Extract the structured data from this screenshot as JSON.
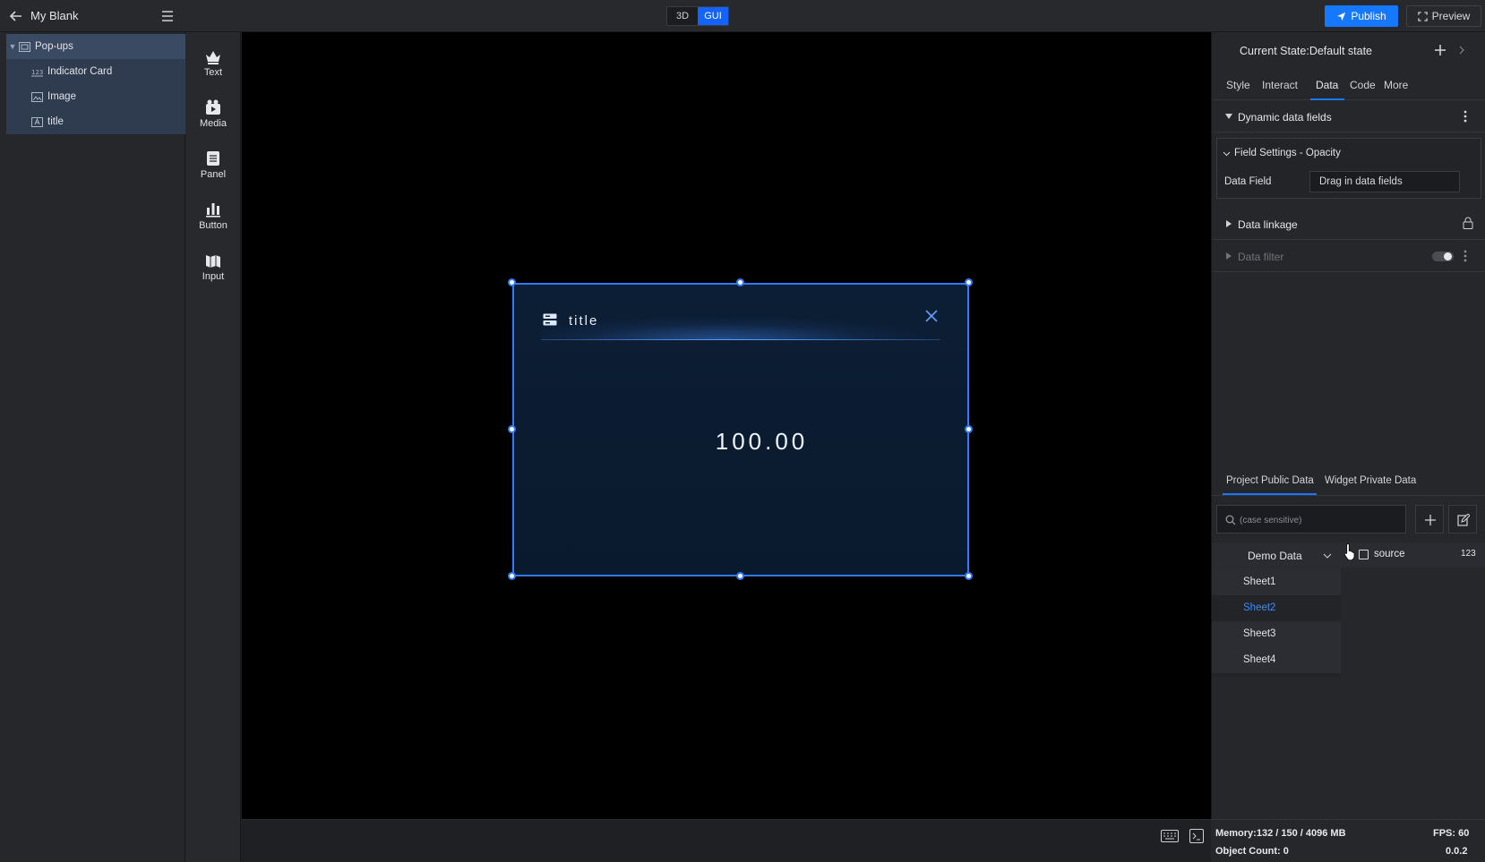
{
  "app": {
    "title": "My Blank"
  },
  "mode_switch": {
    "options": [
      "3D",
      "GUI"
    ],
    "active": "GUI"
  },
  "header": {
    "publish_label": "Publish",
    "preview_label": "Preview"
  },
  "layers": {
    "root": {
      "label": "Pop-ups",
      "icon": "popup-layer-icon"
    },
    "children": [
      {
        "label": "Indicator Card",
        "icon": "indicator-layer-icon"
      },
      {
        "label": "Image",
        "icon": "image-layer-icon"
      },
      {
        "label": "title",
        "icon": "text-layer-icon"
      }
    ]
  },
  "palette": [
    {
      "label": "Text",
      "icon": "text-component-icon"
    },
    {
      "label": "Media",
      "icon": "media-component-icon"
    },
    {
      "label": "Panel",
      "icon": "panel-component-icon"
    },
    {
      "label": "Button",
      "icon": "button-component-icon"
    },
    {
      "label": "Input",
      "icon": "input-component-icon"
    }
  ],
  "popup": {
    "title": "title",
    "value": "100.00"
  },
  "properties": {
    "current_state": "Current State:Default state",
    "tabs": [
      "Style",
      "Interact",
      "Data",
      "Code",
      "More"
    ],
    "active_tab": "Data",
    "dynamic_fields_title": "Dynamic data fields",
    "field_settings_title": "Field Settings - Opacity",
    "data_field_label": "Data Field",
    "data_field_placeholder": "Drag in data fields",
    "data_linkage_title": "Data linkage",
    "data_filter_title": "Data filter"
  },
  "data_panel": {
    "tabs": [
      "Project Public Data",
      "Widget Private Data"
    ],
    "active_tab": "Project Public Data",
    "search_placeholder": "(case sensitive)",
    "source_group": "Demo Data",
    "sheets": [
      "Sheet1",
      "Sheet2",
      "Sheet3",
      "Sheet4"
    ],
    "active_sheet": "Sheet2",
    "fields": [
      {
        "name": "source",
        "type": "123"
      }
    ]
  },
  "status": {
    "memory": "Memory:132 / 150 / 4096 MB",
    "fps": "FPS: 60",
    "object_count": "Object Count: 0",
    "version": "0.0.2"
  },
  "colors": {
    "accent": "#1677ff",
    "canvas": "#000000",
    "selection": "#2f7bff"
  }
}
